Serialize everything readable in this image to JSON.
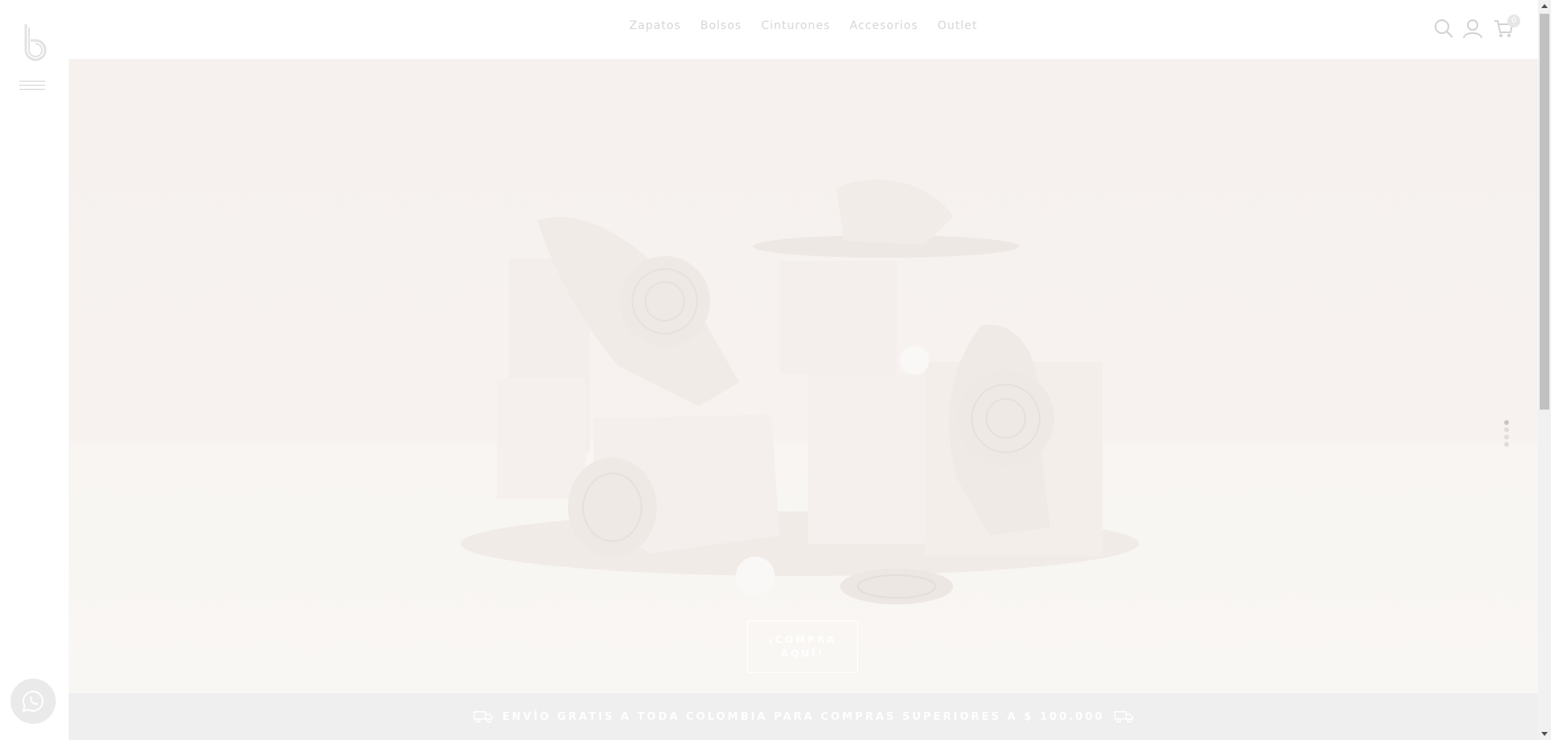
{
  "nav": {
    "items": [
      "Zapatos",
      "Bolsos",
      "Cinturones",
      "Accesorios",
      "Outlet"
    ]
  },
  "header": {
    "cart_count": "0",
    "icons": [
      "search-icon",
      "user-icon",
      "cart-icon"
    ]
  },
  "hero": {
    "cta_line1": "¡COMPRA",
    "cta_line2": "AQUÍ!",
    "slides": 4,
    "active_slide": 1
  },
  "banner": {
    "text": "ENVÍO GRATIS A TODA COLOMBIA PARA COMPRAS SUPERIORES A $ 100.000"
  },
  "colors": {
    "nav_text": "#d6d6d6",
    "hero_bg": "#f6f1ef",
    "banner_bg": "#efefef"
  }
}
